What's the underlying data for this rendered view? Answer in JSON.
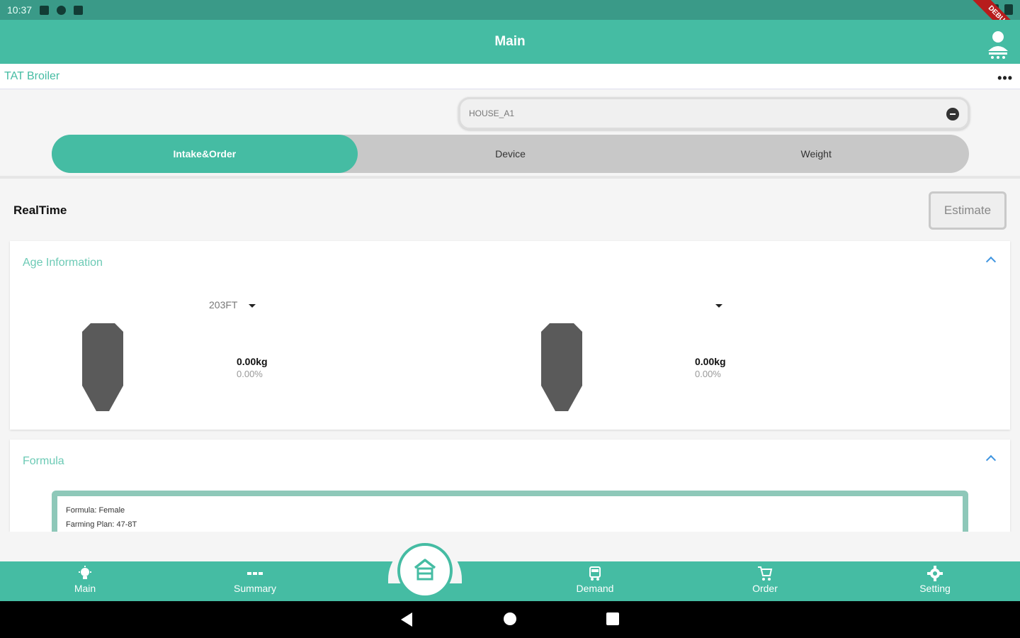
{
  "status_bar": {
    "time": "10:37"
  },
  "debug_banner": "DEBUG",
  "app_bar": {
    "title": "Main"
  },
  "sub_bar": {
    "brand": "TAT Broiler",
    "more_label": "•••"
  },
  "house_select": {
    "value": "HOUSE_A1"
  },
  "tabs": [
    {
      "label": "Intake&Order",
      "active": true
    },
    {
      "label": "Device",
      "active": false
    },
    {
      "label": "Weight",
      "active": false
    }
  ],
  "realtime": {
    "title": "RealTime",
    "estimate_label": "Estimate"
  },
  "age_card": {
    "title": "Age Information",
    "silos": [
      {
        "dropdown": "203FT",
        "kg": "0.00kg",
        "percent": "0.00%",
        "fill": 0
      },
      {
        "dropdown": "",
        "kg": "0.00kg",
        "percent": "0.00%",
        "fill": 0
      }
    ]
  },
  "formula_card": {
    "title": "Formula",
    "formula_line": "Formula: Female",
    "plan_line": "Farming Plan: 47-8T"
  },
  "bottom_nav": {
    "items": [
      {
        "label": "Main",
        "icon": "lightbulb-icon"
      },
      {
        "label": "Summary",
        "icon": "dots-icon"
      },
      {
        "label": "Demand",
        "icon": "truck-icon"
      },
      {
        "label": "Order",
        "icon": "cart-icon"
      },
      {
        "label": "Setting",
        "icon": "gear-icon"
      }
    ],
    "fab_icon": "barn-icon"
  },
  "colors": {
    "primary": "#45bca3",
    "status_bar": "#3a9a88",
    "silo": "#5a5a5a",
    "accent_blue": "#3f95e0"
  }
}
